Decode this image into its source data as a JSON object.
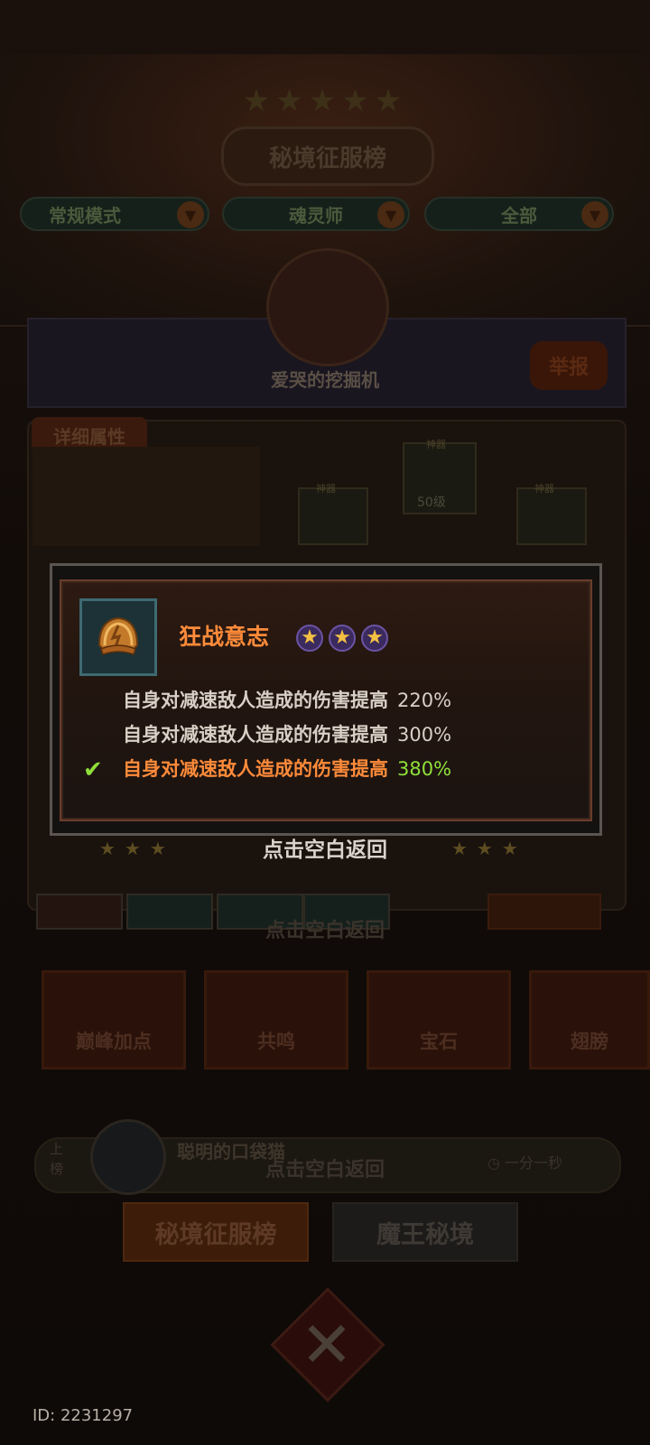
{
  "background": {
    "title": "秘境征服榜",
    "filters": [
      "常规模式",
      "魂灵师",
      "全部"
    ],
    "player_name": "爱哭的挖掘机",
    "report_button": "举报",
    "detail_tag": "详细属性",
    "slot_labels": [
      "神器",
      "神器",
      "神器"
    ],
    "slot_level": "50级",
    "dismiss_hint": "点击空白返回",
    "skills": [
      "巅峰加点",
      "共鸣",
      "宝石",
      "翅膀"
    ],
    "rank_up_label": "上\n榜",
    "rank_player_name": "聪明的口袋猫",
    "rank_time": "一分一秒",
    "tab_active": "秘境征服榜",
    "tab_inactive": "魔王秘境",
    "id_label": "ID: 2231297"
  },
  "modal": {
    "skill_name": "狂战意志",
    "star_count": 3,
    "levels": [
      {
        "text": "自身对减速敌人造成的伤害提高",
        "value": "220%",
        "active": false
      },
      {
        "text": "自身对减速敌人造成的伤害提高",
        "value": "300%",
        "active": false
      },
      {
        "text": "自身对减速敌人造成的伤害提高",
        "value": "380%",
        "active": true
      }
    ],
    "dismiss_hint": "点击空白返回"
  },
  "colors": {
    "skill_name": "#ff8b3a",
    "active_text": "#ff8b3a",
    "active_value": "#8fe03a",
    "inactive_text": "#d8d0c6"
  }
}
